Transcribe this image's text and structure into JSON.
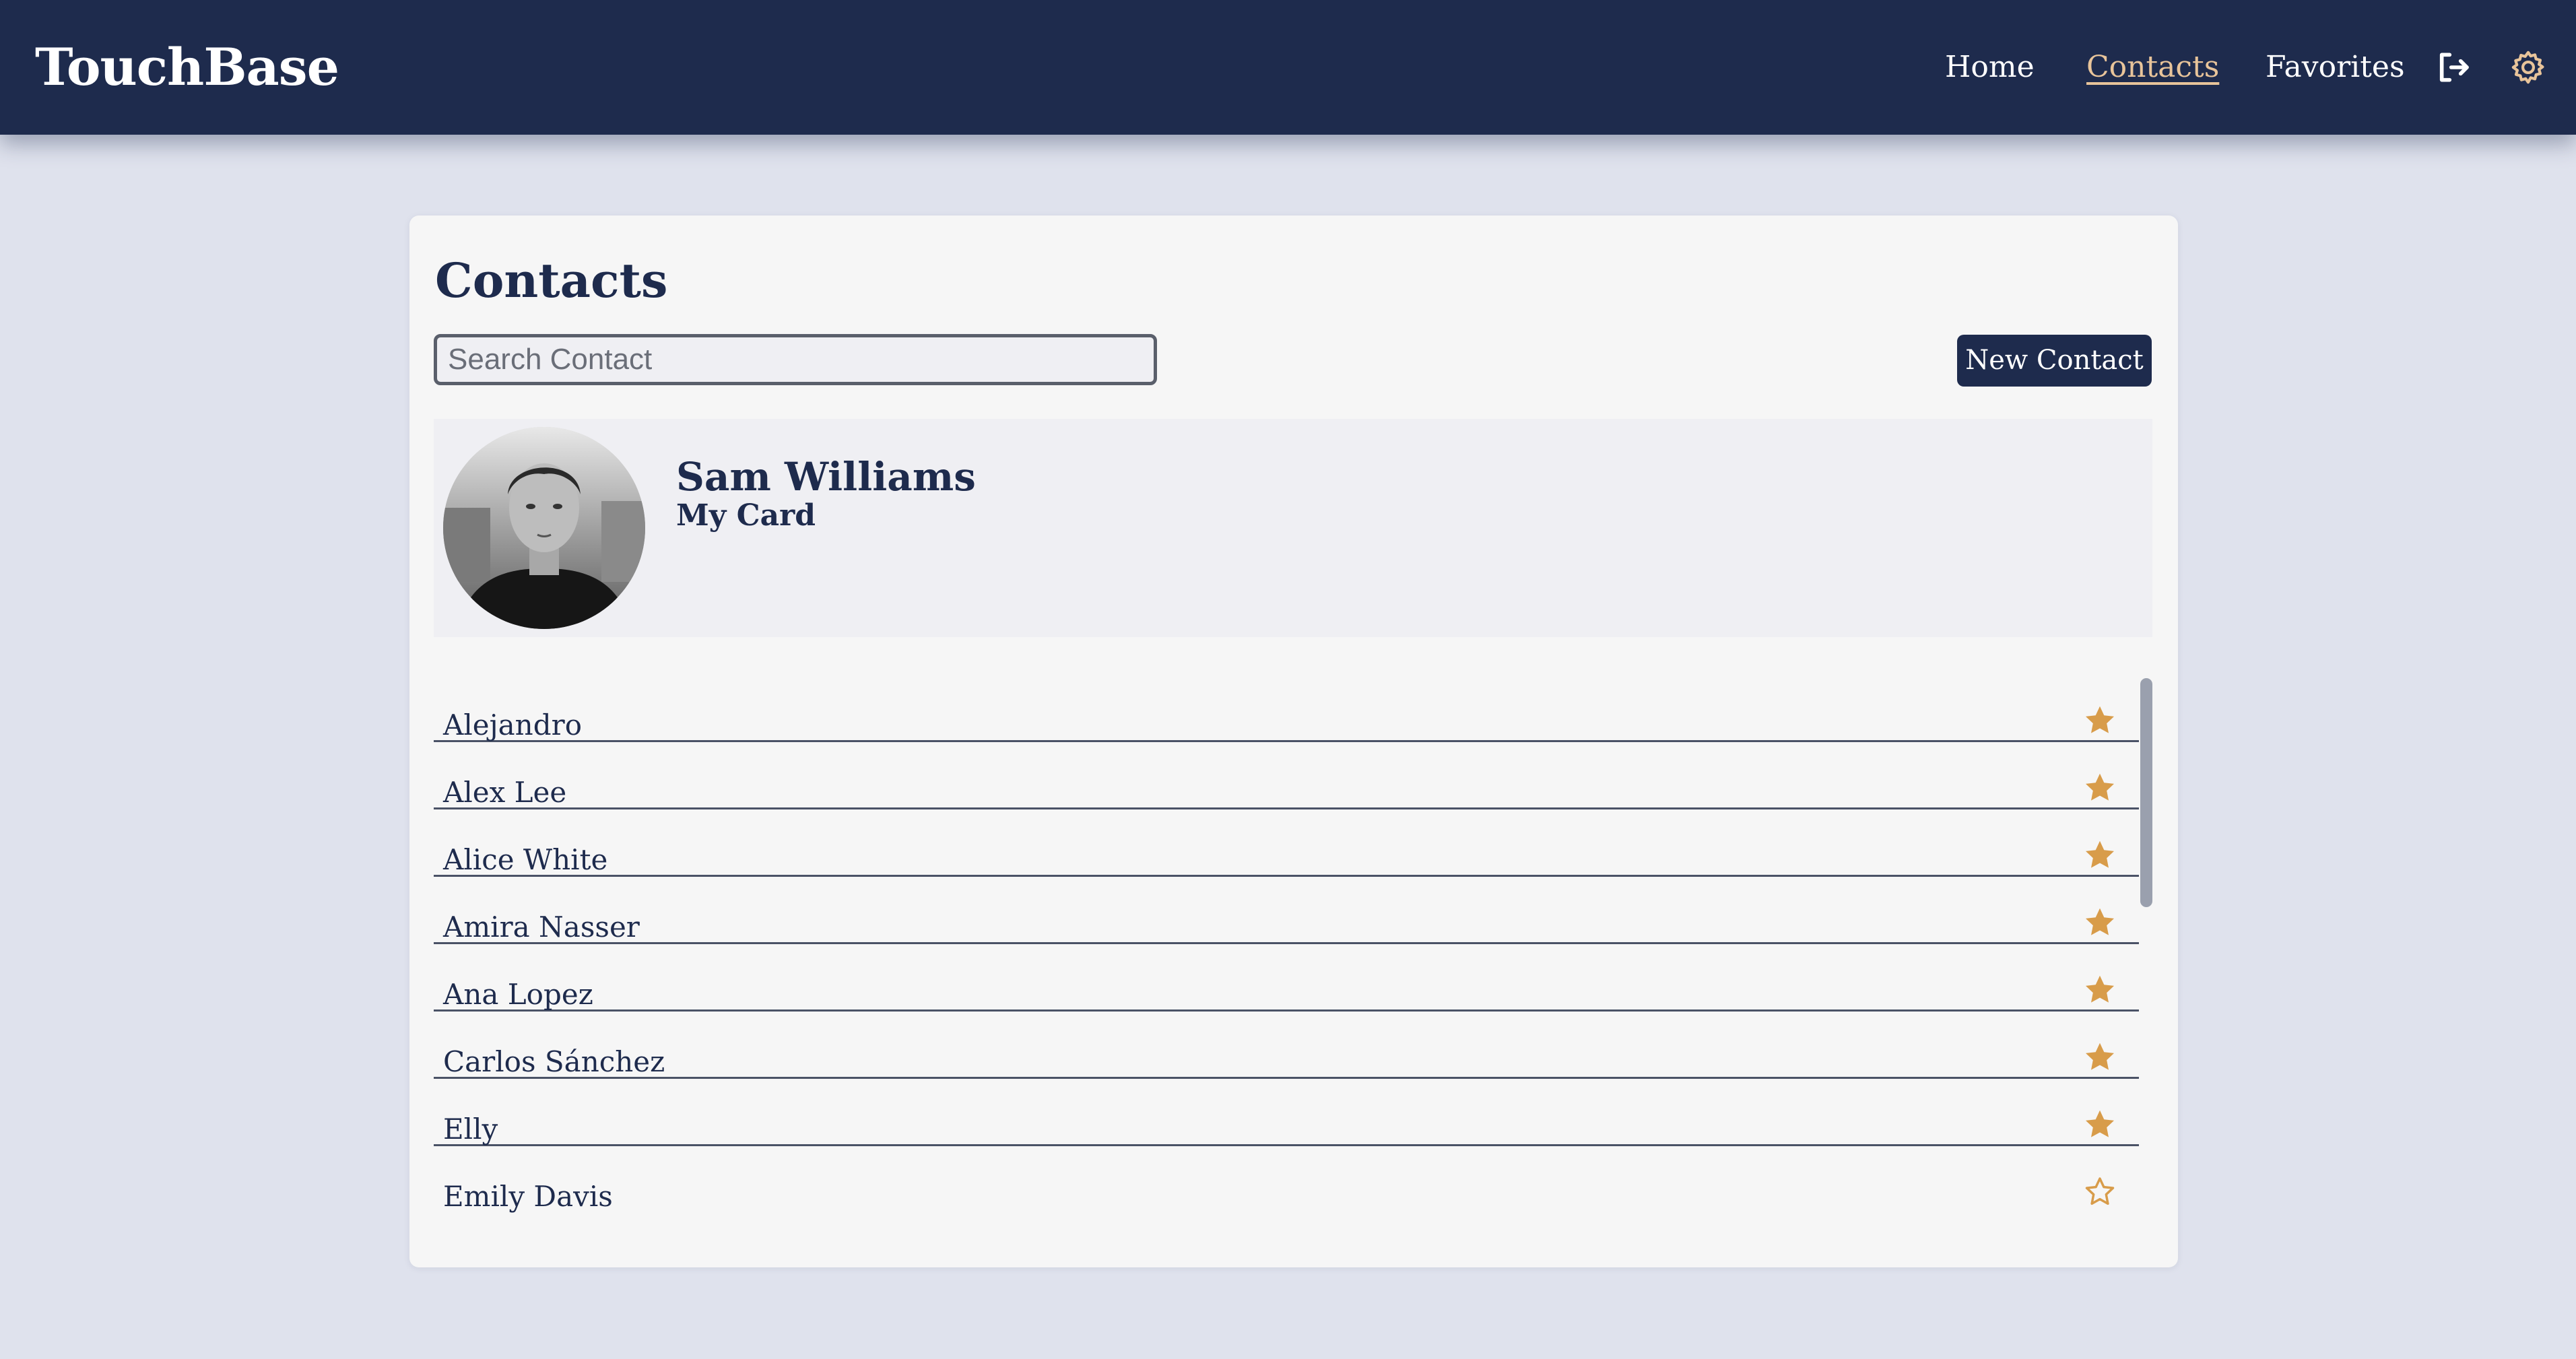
{
  "app": {
    "brand": "TouchBase"
  },
  "nav": {
    "home": "Home",
    "contacts": "Contacts",
    "favorites": "Favorites",
    "logout_icon": "logout-icon",
    "settings_icon": "gear-icon"
  },
  "page": {
    "title": "Contacts",
    "search_placeholder": "Search Contact",
    "new_contact_label": "New Contact"
  },
  "my_card": {
    "name": "Sam Williams",
    "subtitle": "My Card"
  },
  "contacts": [
    {
      "name": "Alejandro",
      "favorite": true
    },
    {
      "name": "Alex Lee",
      "favorite": true
    },
    {
      "name": "Alice White",
      "favorite": true
    },
    {
      "name": "Amira Nasser",
      "favorite": true
    },
    {
      "name": "Ana Lopez",
      "favorite": true
    },
    {
      "name": "Carlos Sánchez",
      "favorite": true
    },
    {
      "name": "Elly",
      "favorite": true
    },
    {
      "name": "Emily Davis",
      "favorite": false
    }
  ],
  "colors": {
    "navy": "#1e2b4d",
    "accent": "#d89c4a",
    "active_link": "#e8c49a",
    "background": "#dfe2ed"
  }
}
